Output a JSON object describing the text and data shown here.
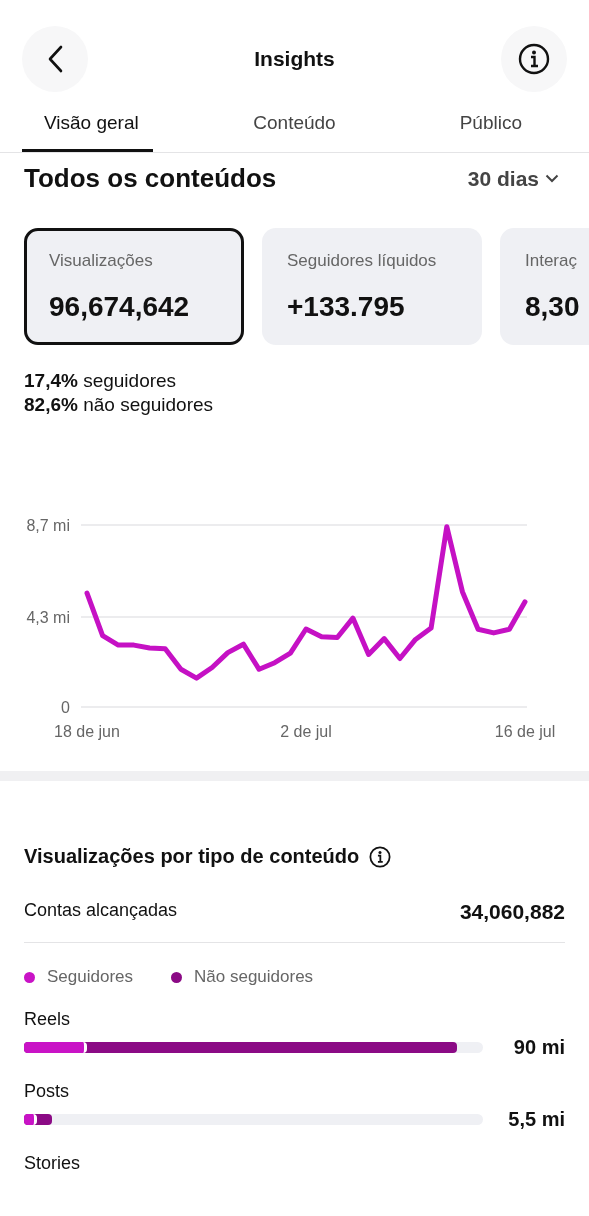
{
  "header": {
    "title": "Insights"
  },
  "tabs": [
    {
      "label": "Visão geral",
      "selected": true
    },
    {
      "label": "Conteúdo",
      "selected": false
    },
    {
      "label": "Público",
      "selected": false
    }
  ],
  "section": {
    "title": "Todos os conteúdos",
    "period": "30 dias"
  },
  "cards": [
    {
      "label": "Visualizações",
      "value": "96,674,642",
      "selected": true
    },
    {
      "label": "Seguidores líquidos",
      "value": "+133.795",
      "selected": false
    },
    {
      "label": "Interaç",
      "value": "8,30",
      "selected": false
    }
  ],
  "breakdown": [
    {
      "share": "17,4%",
      "label": "seguidores"
    },
    {
      "share": "82,6%",
      "label": "não seguidores"
    }
  ],
  "chart_data": {
    "type": "line",
    "categories": [
      "18 de jun",
      null,
      null,
      null,
      null,
      null,
      null,
      null,
      null,
      null,
      null,
      null,
      null,
      null,
      "2 de jul",
      null,
      null,
      null,
      null,
      null,
      null,
      null,
      null,
      null,
      null,
      null,
      null,
      null,
      "16 de jul"
    ],
    "series": [
      {
        "color": "#c511c4",
        "values": [
          5.44,
          3.41,
          2.96,
          2.96,
          2.82,
          2.78,
          1.8,
          1.38,
          1.89,
          2.6,
          3.0,
          1.8,
          2.12,
          2.57,
          3.73,
          3.36,
          3.32,
          4.25,
          2.51,
          3.27,
          2.32,
          3.23,
          3.77,
          8.62,
          5.51,
          3.72,
          3.54,
          3.72,
          5.03
        ]
      }
    ],
    "ylim": [
      0,
      8.7
    ],
    "yticks": [
      {
        "value": 0,
        "label": "0"
      },
      {
        "value": 4.3,
        "label": "4,3 mi"
      },
      {
        "value": 8.7,
        "label": "8,7 mi"
      }
    ]
  },
  "by_type": {
    "title": "Visualizações por tipo de conteúdo",
    "reach_label": "Contas alcançadas",
    "reach_value": "34,060,882",
    "legend": [
      {
        "label": "Seguidores",
        "color": "#c913c6"
      },
      {
        "label": "Não seguidores",
        "color": "#8b0a85"
      }
    ],
    "rows": [
      {
        "label": "Reels",
        "value": "90 mi",
        "segments": [
          {
            "level": 0.137
          },
          {
            "level": 0.943
          }
        ]
      },
      {
        "label": "Posts",
        "value": "5,5 mi",
        "segments": [
          {
            "level": 0.028
          },
          {
            "level": 0.061
          }
        ]
      },
      {
        "label": "Stories"
      }
    ]
  }
}
